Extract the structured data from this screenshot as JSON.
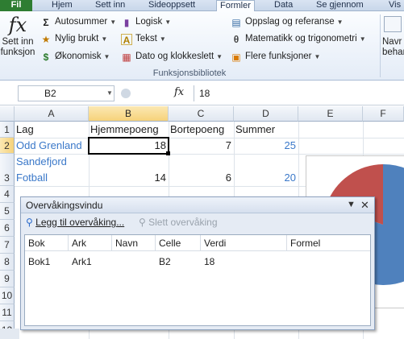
{
  "ribbon_tabs": [
    "Fil",
    "Hjem",
    "Sett inn",
    "Sideoppsett",
    "Formler",
    "Data",
    "Se gjennom",
    "Vis"
  ],
  "ribbon": {
    "insert_function": {
      "line1": "Sett inn",
      "line2": "funksjon",
      "icon": "fx-icon"
    },
    "autosum": "Autosummer",
    "recent": "Nylig brukt",
    "financial": "Økonomisk",
    "logical": "Logisk",
    "text": "Tekst",
    "datetime": "Dato og klokkeslett",
    "lookup": "Oppslag og referanse",
    "math": "Matematikk og trigonometri",
    "more": "Flere funksjoner",
    "group_label": "Funksjonsbibliotek",
    "name_mgr_line1": "Navr",
    "name_mgr_line2": "behan"
  },
  "formula_bar": {
    "name_box": "B2",
    "fx": "fx",
    "content": "18"
  },
  "columns": [
    "A",
    "B",
    "C",
    "D",
    "E",
    "F"
  ],
  "rows": [
    "1",
    "2",
    "",
    "3",
    "4",
    "5",
    "6",
    "7",
    "8",
    "9",
    "10",
    "11",
    "12",
    "13"
  ],
  "sheet": {
    "headers": [
      "Lag",
      "Hjemmepoeng",
      "Bortepoeng",
      "Summer"
    ],
    "row2": {
      "team": "Odd Grenland",
      "home": "18",
      "away": "7",
      "sum": "25"
    },
    "row3": {
      "team_line1": "Sandefjord",
      "team_line2": "Fotball",
      "home": "14",
      "away": "6",
      "sum": "20"
    }
  },
  "chart": {
    "colors": {
      "slice1": "#4f81bd",
      "slice2": "#c0504d"
    }
  },
  "watch_window": {
    "title": "Overvåkingsvindu",
    "add": "Legg til overvåking...",
    "delete": "Slett overvåking",
    "columns": [
      "Bok",
      "Ark",
      "Navn",
      "Celle",
      "Verdi",
      "Formel"
    ],
    "items": [
      {
        "book": "Bok1",
        "sheet": "Ark1",
        "name": "",
        "cell": "B2",
        "value": "18",
        "formula": ""
      }
    ]
  }
}
